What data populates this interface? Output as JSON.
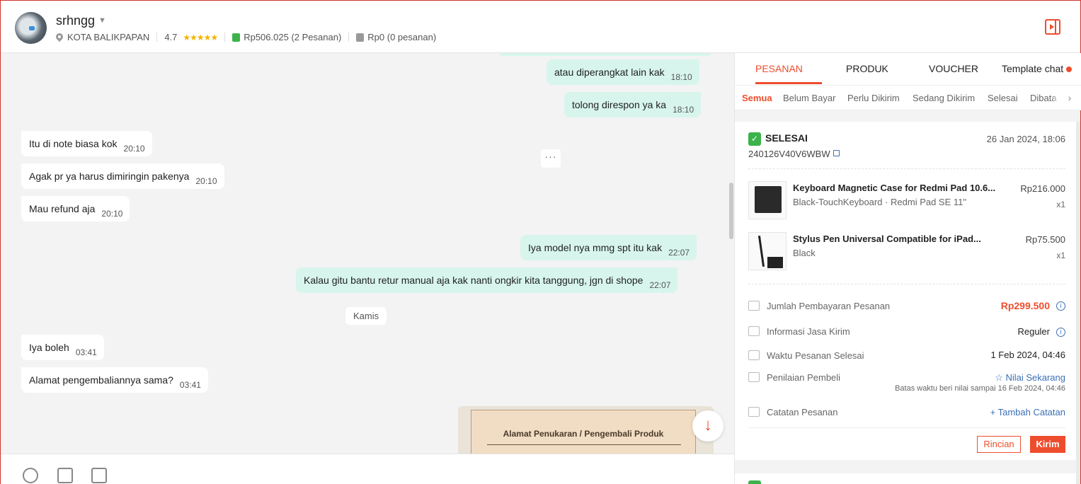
{
  "header": {
    "username": "srhngg",
    "location": "KOTA BALIKPAPAN",
    "rating": "4.7",
    "stars": "★★★★★",
    "paid_total": "Rp506.025",
    "paid_orders": "(2 Pesanan)",
    "unpaid_total": "Rp0",
    "unpaid_orders": "(0 pesanan)"
  },
  "chat": {
    "messages": [
      {
        "dir": "out",
        "text": "atau diperangkat lain kak",
        "time": "18:10"
      },
      {
        "dir": "out",
        "text": "tolong direspon ya ka",
        "time": "18:10"
      },
      {
        "dir": "in",
        "text": "Itu di note biasa kok",
        "time": "20:10"
      },
      {
        "dir": "in",
        "text": "Agak pr ya harus dimiringin pakenya",
        "time": "20:10"
      },
      {
        "dir": "in",
        "text": "Mau refund aja",
        "time": "20:10"
      },
      {
        "dir": "out",
        "text": "Iya model nya mmg spt itu kak",
        "time": "22:07"
      },
      {
        "dir": "out",
        "text": "Kalau gitu bantu retur manual aja kak nanti ongkir kita tanggung, jgn di shope",
        "time": "22:07"
      },
      {
        "dir": "in",
        "text": "Iya boleh",
        "time": "03:41"
      },
      {
        "dir": "in",
        "text": "Alamat pengembaliannya sama?",
        "time": "03:41"
      }
    ],
    "more_dots": "···",
    "day_divider": "Kamis",
    "image_card_title": "Alamat Penukaran / Pengembali Produk",
    "scroll_down_glyph": "↓"
  },
  "panel": {
    "tabs": [
      "PESANAN",
      "PRODUK",
      "VOUCHER",
      "Template chat"
    ],
    "subtabs": [
      "Semua",
      "Belum Bayar",
      "Perlu Dikirim",
      "Sedang Dikirim",
      "Selesai",
      "Dibata"
    ],
    "subtab_arrow": "›",
    "order": {
      "status": "SELESAI",
      "status_check": "✓",
      "date": "26 Jan 2024, 18:06",
      "id": "240126V40V6WBW",
      "products": [
        {
          "name": "Keyboard Magnetic Case for Redmi Pad 10.6...",
          "variant": "Black-TouchKeyboard · Redmi Pad SE 11\"",
          "price": "Rp216.000",
          "qty": "x1"
        },
        {
          "name": "Stylus Pen Universal Compatible for iPad...",
          "variant": "Black",
          "price": "Rp75.500",
          "qty": "x1"
        }
      ],
      "payment_label": "Jumlah Pembayaran Pesanan",
      "payment_value": "Rp299.500",
      "shipping_label": "Informasi Jasa Kirim",
      "shipping_value": "Reguler",
      "finish_label": "Waktu Pesanan Selesai",
      "finish_value": "1 Feb 2024, 04:46",
      "review_label": "Penilaian Pembeli",
      "review_value": "☆ Nilai Sekarang",
      "review_deadline": "Batas waktu beri nilai sampai 16 Feb 2024, 04:46",
      "note_label": "Catatan Pesanan",
      "note_value": "+ Tambah Catatan",
      "info_glyph": "i",
      "btn_detail": "Rincian",
      "btn_send": "Kirim"
    }
  },
  "colors": {
    "accent": "#ee4d2d",
    "outgoing_bubble": "#d7f5ec",
    "link": "#3b6fb6",
    "success": "#3bb34a"
  }
}
